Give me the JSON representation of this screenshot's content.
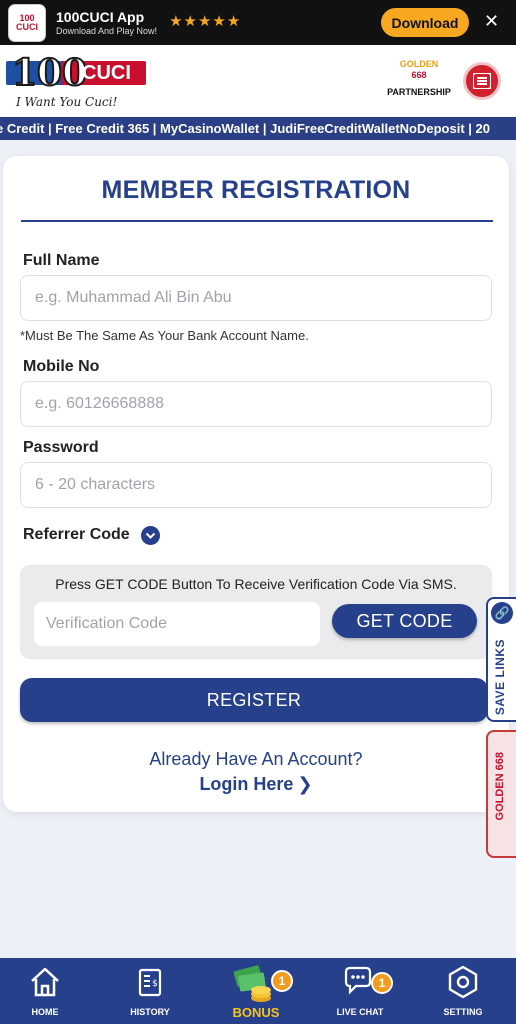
{
  "app_banner": {
    "title": "100CUCI App",
    "subtitle": "Download And Play Now!",
    "stars": "★★★★★",
    "download_label": "Download",
    "close_label": "✕"
  },
  "header": {
    "logo_number": "100",
    "logo_word": "CUCI",
    "logo_tagline": "I Want You Cuci!",
    "partner_logo_a": "GOLDEN",
    "partner_logo_b": "668",
    "partner_label": "PARTNERSHIP"
  },
  "ticker": {
    "text": "e Credit | Free Credit 365 | MyCasinoWallet | JudiFreeCreditWalletNoDeposit | 20"
  },
  "form": {
    "title": "MEMBER REGISTRATION",
    "full_name_label": "Full Name",
    "full_name_placeholder": "e.g. Muhammad Ali Bin Abu",
    "full_name_note": "*Must Be The Same As Your Bank Account Name.",
    "mobile_label": "Mobile No",
    "mobile_placeholder": "e.g. 60126668888",
    "password_label": "Password",
    "password_placeholder": "6 - 20 characters",
    "referrer_label": "Referrer Code",
    "verify_instruction": "Press GET CODE Button To Receive Verification Code Via SMS.",
    "verify_placeholder": "Verification Code",
    "get_code_label": "GET CODE",
    "register_label": "REGISTER",
    "have_account": "Already Have An Account?",
    "login_label": "Login Here"
  },
  "side_tabs": {
    "save_links": "SAVE LINKS",
    "partner": "GOLDEN 668"
  },
  "bottom_nav": {
    "items": [
      {
        "label": "HOME",
        "icon": "home-icon"
      },
      {
        "label": "HISTORY",
        "icon": "history-icon"
      },
      {
        "label": "BONUS",
        "icon": "bonus-icon",
        "badge": "1"
      },
      {
        "label": "LIVE CHAT",
        "icon": "live-chat-icon",
        "badge": "1"
      },
      {
        "label": "SETTING",
        "icon": "setting-icon"
      }
    ]
  },
  "colors": {
    "primary": "#27408b",
    "accent": "#f6a821",
    "badge": "#f39b1c"
  }
}
